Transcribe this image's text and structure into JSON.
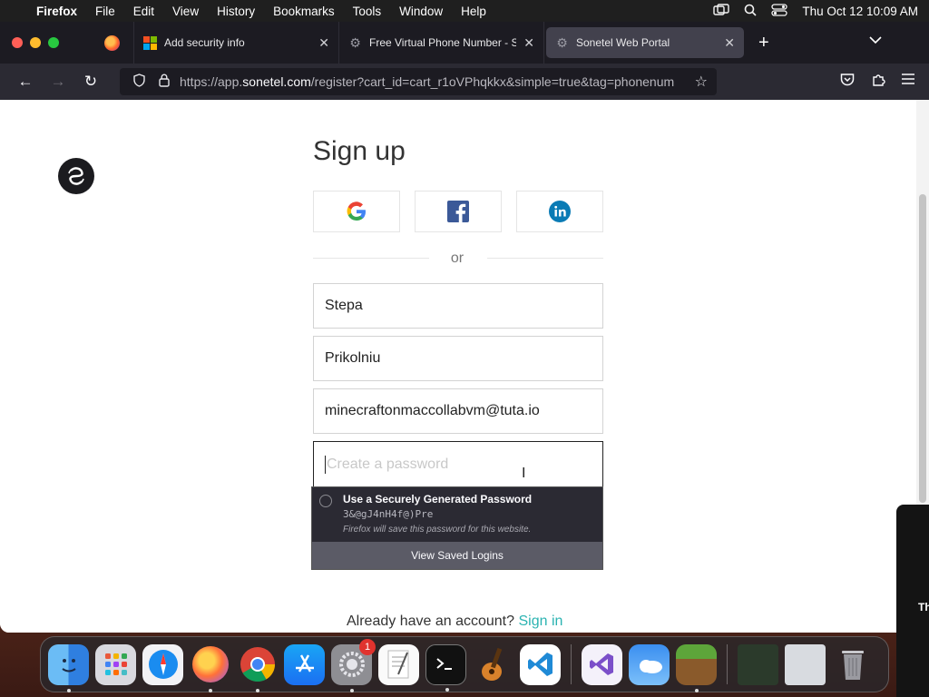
{
  "menubar": {
    "apple": "",
    "items": [
      "Firefox",
      "File",
      "Edit",
      "View",
      "History",
      "Bookmarks",
      "Tools",
      "Window",
      "Help"
    ],
    "clock": "Thu Oct 12  10:09 AM"
  },
  "tabs": [
    {
      "label": "Add security info",
      "icon": "microsoft-icon"
    },
    {
      "label": "Free Virtual Phone Number - So",
      "icon": "settings-icon"
    },
    {
      "label": "Sonetel Web Portal",
      "icon": "settings-icon",
      "active": true
    }
  ],
  "urlbar": {
    "prefix": "https://app.",
    "domain": "sonetel.com",
    "rest": "/register?cart_id=cart_r1oVPhqkkx&simple=true&tag=phonenum"
  },
  "page": {
    "title": "Sign up",
    "or_text": "or",
    "first_name_value": "Stepa",
    "last_name_value": "Prikolniu",
    "email_value": "minecraftonmaccollabvm@tuta.io",
    "password_placeholder": "Create a password",
    "already_text": "Already have an account?",
    "sign_in_link": "Sign in"
  },
  "password_popup": {
    "heading": "Use a Securely Generated Password",
    "generated_password": "3&@gJ4nH4f@)Pre",
    "note": "Firefox will save this password for this website.",
    "view_saved": "View Saved Logins"
  },
  "side_overlay_text": "Th",
  "dock": {
    "settings_badge": "1"
  },
  "colors": {
    "accent_link": "#2bb3b1",
    "menubar_bg": "#1f1f1f",
    "tabbar_bg": "#1c1b22"
  }
}
